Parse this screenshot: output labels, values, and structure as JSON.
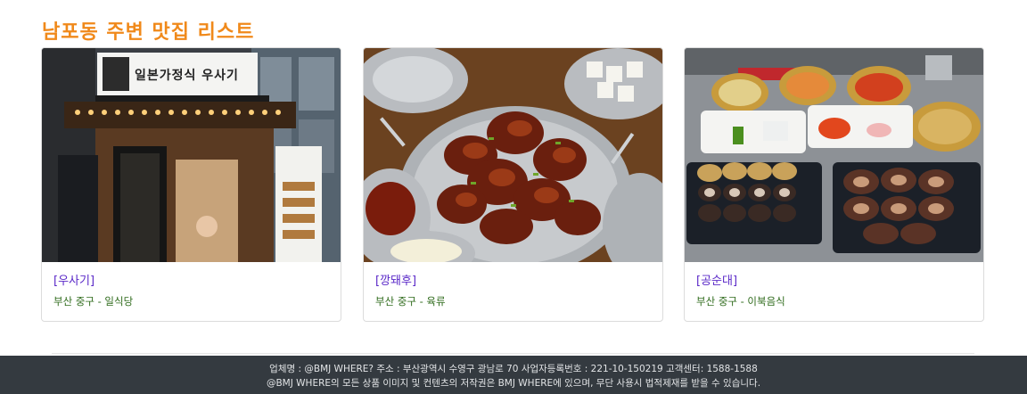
{
  "page": {
    "title": "남포동 주변 맛집 리스트"
  },
  "restaurants": [
    {
      "name": "[우사기]",
      "location": "부산 중구 - 일식당",
      "sign_text": "일본가정식 우사기"
    },
    {
      "name": "[깡돼후]",
      "location": "부산 중구 - 육류"
    },
    {
      "name": "[공순대]",
      "location": "부산 중구 - 이북음식"
    }
  ],
  "footer": {
    "line1": "업체명 : @BMJ WHERE? 주소 : 부산광역시 수영구 광남로 70 사업자등록번호 : 221-10-150219 고객센터: 1588-1588",
    "line2": "@BMJ WHERE의 모든 상품 이미지 및 컨텐츠의 저작권은 BMJ WHERE에 있으며, 무단 사용시 법적제재를 받을 수 있습니다."
  },
  "colors": {
    "title": "#f0891a",
    "link": "#5a28c8",
    "location": "#2f6b1c",
    "footer_bg": "#343a40"
  }
}
